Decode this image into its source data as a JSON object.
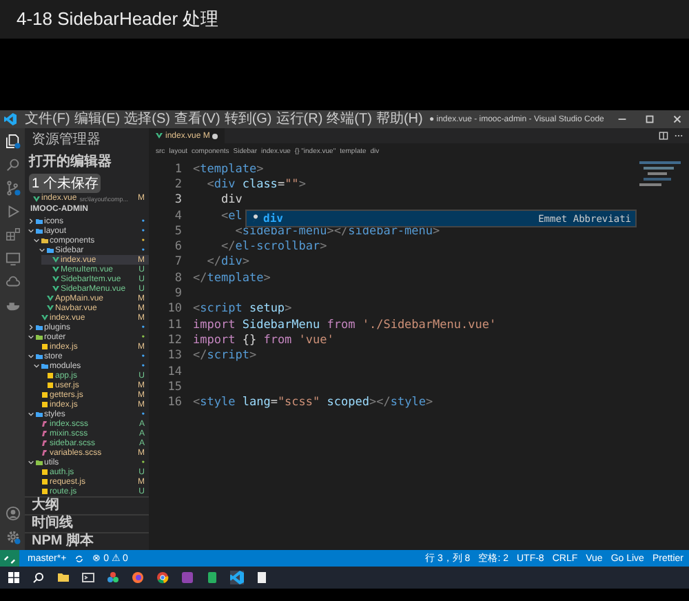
{
  "video_title": "4-18 SidebarHeader 处理",
  "window": {
    "title": "● index.vue - imooc-admin - Visual Studio Code",
    "menu": [
      "文件(F)",
      "编辑(E)",
      "选择(S)",
      "查看(V)",
      "转到(G)",
      "运行(R)",
      "终端(T)",
      "帮助(H)"
    ]
  },
  "sidebar": {
    "title": "资源管理器",
    "open_editors": {
      "label": "打开的编辑器",
      "badge": "1 个未保存",
      "files": [
        {
          "name": "index.vue",
          "path": "src\\layout\\comp...",
          "status": "M"
        }
      ]
    },
    "project": "IMOOC-ADMIN",
    "tree": [
      {
        "name": "icons",
        "kind": "folder",
        "expanded": false,
        "selected": false,
        "color": "#42a5f5",
        "status": "•"
      },
      {
        "name": "layout",
        "kind": "folder",
        "expanded": true,
        "selected": false,
        "color": "#42a5f5",
        "status": "•",
        "children": [
          {
            "name": "components",
            "kind": "folder",
            "expanded": true,
            "selected": false,
            "color": "#e2b93d",
            "status": "•",
            "children": [
              {
                "name": "Sidebar",
                "kind": "folder",
                "expanded": true,
                "selected": false,
                "color": "#42a5f5",
                "status": "•",
                "children": [
                  {
                    "name": "index.vue",
                    "kind": "vue",
                    "selected": true,
                    "color": "#e2c08d",
                    "status": "M"
                  },
                  {
                    "name": "MenuItem.vue",
                    "kind": "vue",
                    "selected": false,
                    "color": "#73c991",
                    "status": "U"
                  },
                  {
                    "name": "SidebarItem.vue",
                    "kind": "vue",
                    "selected": false,
                    "color": "#73c991",
                    "status": "U"
                  },
                  {
                    "name": "SidebarMenu.vue",
                    "kind": "vue",
                    "selected": false,
                    "color": "#73c991",
                    "status": "U"
                  }
                ]
              },
              {
                "name": "AppMain.vue",
                "kind": "vue",
                "selected": false,
                "color": "#e2c08d",
                "status": "M"
              },
              {
                "name": "Navbar.vue",
                "kind": "vue",
                "selected": false,
                "color": "#e2c08d",
                "status": "M"
              }
            ]
          },
          {
            "name": "index.vue",
            "kind": "vue",
            "selected": false,
            "color": "#e2c08d",
            "status": "M"
          }
        ]
      },
      {
        "name": "plugins",
        "kind": "folder",
        "expanded": false,
        "selected": false,
        "color": "#42a5f5",
        "status": "•"
      },
      {
        "name": "router",
        "kind": "folder",
        "expanded": true,
        "selected": false,
        "color": "#8bc34a",
        "status": "•",
        "children": [
          {
            "name": "index.js",
            "kind": "js",
            "selected": false,
            "color": "#e2c08d",
            "status": "M"
          }
        ]
      },
      {
        "name": "store",
        "kind": "folder",
        "expanded": true,
        "selected": false,
        "color": "#42a5f5",
        "status": "•",
        "children": [
          {
            "name": "modules",
            "kind": "folder",
            "expanded": true,
            "selected": false,
            "color": "#42a5f5",
            "status": "•",
            "children": [
              {
                "name": "app.js",
                "kind": "js",
                "selected": false,
                "color": "#73c991",
                "status": "U"
              },
              {
                "name": "user.js",
                "kind": "js",
                "selected": false,
                "color": "#e2c08d",
                "status": "M"
              }
            ]
          },
          {
            "name": "getters.js",
            "kind": "js",
            "selected": false,
            "color": "#e2c08d",
            "status": "M"
          },
          {
            "name": "index.js",
            "kind": "js",
            "selected": false,
            "color": "#e2c08d",
            "status": "M"
          }
        ]
      },
      {
        "name": "styles",
        "kind": "folder",
        "expanded": true,
        "selected": false,
        "color": "#42a5f5",
        "status": "•",
        "children": [
          {
            "name": "index.scss",
            "kind": "scss",
            "selected": false,
            "color": "#73c991",
            "status": "A"
          },
          {
            "name": "mixin.scss",
            "kind": "scss",
            "selected": false,
            "color": "#73c991",
            "status": "A"
          },
          {
            "name": "sidebar.scss",
            "kind": "scss",
            "selected": false,
            "color": "#73c991",
            "status": "A"
          },
          {
            "name": "variables.scss",
            "kind": "scss",
            "selected": false,
            "color": "#e2c08d",
            "status": "M"
          }
        ]
      },
      {
        "name": "utils",
        "kind": "folder",
        "expanded": true,
        "selected": false,
        "color": "#8bc34a",
        "status": "•",
        "children": [
          {
            "name": "auth.js",
            "kind": "js",
            "selected": false,
            "color": "#73c991",
            "status": "U"
          },
          {
            "name": "request.js",
            "kind": "js",
            "selected": false,
            "color": "#e2c08d",
            "status": "M"
          },
          {
            "name": "route.js",
            "kind": "js",
            "selected": false,
            "color": "#73c991",
            "status": "U"
          }
        ]
      }
    ],
    "panels": [
      "大纲",
      "时间线",
      "NPM 脚本"
    ]
  },
  "editor": {
    "tabs": [
      {
        "name": "index.vue",
        "status": "M",
        "dirty": true,
        "selected": true
      }
    ],
    "breadcrumb": [
      "src",
      "layout",
      "components",
      "Sidebar",
      "index.vue",
      "{} \"index.vue\"",
      "template",
      "div"
    ],
    "lines": [
      {
        "number": "1",
        "current": false,
        "tokens": [
          {
            "kind": "p",
            "text": "<"
          },
          {
            "kind": "tag",
            "text": "template"
          },
          {
            "kind": "p",
            "text": ">"
          }
        ]
      },
      {
        "number": "2",
        "current": false,
        "tokens": [
          {
            "kind": "p",
            "text": "  <"
          },
          {
            "kind": "tag",
            "text": "div"
          },
          {
            "kind": "attr",
            "text": " class"
          },
          {
            "kind": "plain",
            "text": "="
          },
          {
            "kind": "str",
            "text": "\"\""
          },
          {
            "kind": "p",
            "text": ">"
          }
        ]
      },
      {
        "number": "3",
        "current": true,
        "tokens": [
          {
            "kind": "plain",
            "text": "    div"
          }
        ]
      },
      {
        "number": "4",
        "current": false,
        "tokens": [
          {
            "kind": "p",
            "text": "    <"
          },
          {
            "kind": "tag",
            "text": "el"
          }
        ]
      },
      {
        "number": "5",
        "current": false,
        "tokens": [
          {
            "kind": "p",
            "text": "      <"
          },
          {
            "kind": "tag",
            "text": "sidebar-menu"
          },
          {
            "kind": "p",
            "text": "></"
          },
          {
            "kind": "tag",
            "text": "sidebar-menu"
          },
          {
            "kind": "p",
            "text": ">"
          }
        ]
      },
      {
        "number": "6",
        "current": false,
        "tokens": [
          {
            "kind": "p",
            "text": "    </"
          },
          {
            "kind": "tag",
            "text": "el-scrollbar"
          },
          {
            "kind": "p",
            "text": ">"
          }
        ]
      },
      {
        "number": "7",
        "current": false,
        "tokens": [
          {
            "kind": "p",
            "text": "  </"
          },
          {
            "kind": "tag",
            "text": "div"
          },
          {
            "kind": "p",
            "text": ">"
          }
        ]
      },
      {
        "number": "8",
        "current": false,
        "tokens": [
          {
            "kind": "p",
            "text": "</"
          },
          {
            "kind": "tag",
            "text": "template"
          },
          {
            "kind": "p",
            "text": ">"
          }
        ]
      },
      {
        "number": "9",
        "current": false
      },
      {
        "number": "10",
        "current": false,
        "tokens": [
          {
            "kind": "p",
            "text": "<"
          },
          {
            "kind": "tag",
            "text": "script"
          },
          {
            "kind": "attr",
            "text": " setup"
          },
          {
            "kind": "p",
            "text": ">"
          }
        ]
      },
      {
        "number": "11",
        "current": false,
        "tokens": [
          {
            "kind": "kw",
            "text": "import"
          },
          {
            "kind": "var",
            "text": " SidebarMenu "
          },
          {
            "kind": "kw",
            "text": "from"
          },
          {
            "kind": "str",
            "text": " './SidebarMenu.vue'"
          }
        ]
      },
      {
        "number": "12",
        "current": false,
        "tokens": [
          {
            "kind": "kw",
            "text": "import"
          },
          {
            "kind": "plain",
            "text": " {} "
          },
          {
            "kind": "kw",
            "text": "from"
          },
          {
            "kind": "str",
            "text": " 'vue'"
          }
        ]
      },
      {
        "number": "13",
        "current": false,
        "tokens": [
          {
            "kind": "p",
            "text": "</"
          },
          {
            "kind": "tag",
            "text": "script"
          },
          {
            "kind": "p",
            "text": ">"
          }
        ]
      },
      {
        "number": "14",
        "current": false
      },
      {
        "number": "15",
        "current": false
      },
      {
        "number": "16",
        "current": false,
        "tokens": [
          {
            "kind": "p",
            "text": "<"
          },
          {
            "kind": "tag",
            "text": "style"
          },
          {
            "kind": "attr",
            "text": " lang"
          },
          {
            "kind": "plain",
            "text": "="
          },
          {
            "kind": "str",
            "text": "\"scss\""
          },
          {
            "kind": "attr",
            "text": " scoped"
          },
          {
            "kind": "p",
            "text": "></"
          },
          {
            "kind": "tag",
            "text": "style"
          },
          {
            "kind": "p",
            "text": ">"
          }
        ]
      }
    ],
    "suggestion": {
      "label": "div",
      "detail": "Emmet Abbreviati"
    }
  },
  "status_bar": {
    "branch": "master*+",
    "problems": "⊗ 0 ⚠ 0",
    "right": [
      "行 3，列 8",
      "空格: 2",
      "UTF-8",
      "CRLF",
      "Vue",
      "Go Live",
      "Prettier"
    ]
  }
}
